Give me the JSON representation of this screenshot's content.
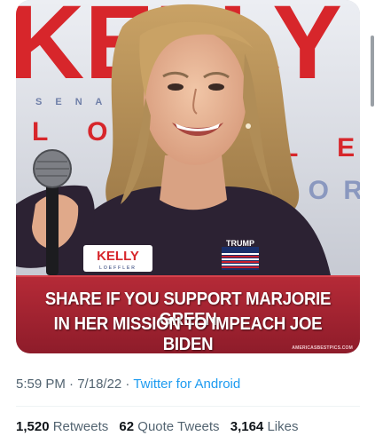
{
  "tweet": {
    "media": {
      "background_sign_text": "KELLY",
      "background_sign_sub": "LOEFFLER",
      "background_sign_side": [
        "S E N A T O R",
        "L O",
        "L E",
        "T O R"
      ],
      "pin_text": "KELLY",
      "pin_subtext": "LOEFFLER",
      "flag_pin_text": "TRUMP",
      "banner_line_1": "SHARE IF YOU SUPPORT MARJORIE GREEN",
      "banner_line_2": "IN HER MISSION TO IMPEACH JOE BIDEN",
      "watermark": "AMERICASBESTPICS.COM"
    },
    "meta": {
      "time": "5:59 PM",
      "separator_1": " · ",
      "date": "7/18/22",
      "separator_2": " · ",
      "source": "Twitter for Android"
    },
    "stats": {
      "retweets_count": "1,520",
      "retweets_label": "Retweets",
      "quote_tweets_count": "62",
      "quote_tweets_label": "Quote Tweets",
      "likes_count": "3,164",
      "likes_label": "Likes"
    }
  },
  "colors": {
    "banner_red": "#b52a37",
    "sign_red": "#d7262b",
    "link_blue": "#1d9bf0",
    "meta_gray": "#536471"
  }
}
